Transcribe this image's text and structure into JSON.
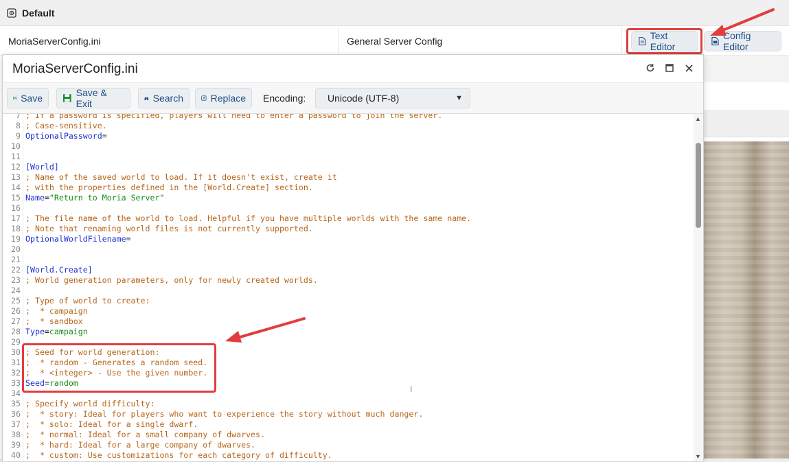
{
  "background": {
    "section_title": "Default",
    "row": {
      "filename": "MoriaServerConfig.ini",
      "description": "General Server Config",
      "text_editor_label": "Text Editor",
      "config_editor_label": "Config Editor"
    }
  },
  "modal": {
    "title": "MoriaServerConfig.ini",
    "toolbar": {
      "save_label": "Save",
      "save_exit_label": "Save & Exit",
      "search_label": "Search",
      "replace_label": "Replace",
      "encoding_label": "Encoding:",
      "encoding_value": "Unicode (UTF-8)"
    }
  },
  "editor": {
    "lines": [
      {
        "n": "7",
        "parts": [
          {
            "t": "; If a password is specified, players will need to enter a password to join the server.",
            "c": "comment"
          }
        ]
      },
      {
        "n": "8",
        "parts": [
          {
            "t": "; Case-sensitive.",
            "c": "comment"
          }
        ]
      },
      {
        "n": "9",
        "parts": [
          {
            "t": "OptionalPassword",
            "c": "key"
          },
          {
            "t": "=",
            "c": "eq"
          }
        ]
      },
      {
        "n": "10",
        "parts": []
      },
      {
        "n": "11",
        "parts": []
      },
      {
        "n": "12",
        "parts": [
          {
            "t": "[World]",
            "c": "section"
          }
        ]
      },
      {
        "n": "13",
        "parts": [
          {
            "t": "; Name of the saved world to load. If it doesn't exist, create it",
            "c": "comment"
          }
        ]
      },
      {
        "n": "14",
        "parts": [
          {
            "t": "; with the properties defined in the [World.Create] section.",
            "c": "comment"
          }
        ]
      },
      {
        "n": "15",
        "parts": [
          {
            "t": "Name",
            "c": "key"
          },
          {
            "t": "=",
            "c": "eq"
          },
          {
            "t": "\"Return to Moria Server\"",
            "c": "str"
          }
        ]
      },
      {
        "n": "16",
        "parts": []
      },
      {
        "n": "17",
        "parts": [
          {
            "t": "; The file name of the world to load. Helpful if you have multiple worlds with the same name.",
            "c": "comment"
          }
        ]
      },
      {
        "n": "18",
        "parts": [
          {
            "t": "; Note that renaming world files is not currently supported.",
            "c": "comment"
          }
        ]
      },
      {
        "n": "19",
        "parts": [
          {
            "t": "OptionalWorldFilename",
            "c": "key"
          },
          {
            "t": "=",
            "c": "eq"
          }
        ]
      },
      {
        "n": "20",
        "parts": []
      },
      {
        "n": "21",
        "parts": []
      },
      {
        "n": "22",
        "parts": [
          {
            "t": "[World.Create]",
            "c": "section"
          }
        ]
      },
      {
        "n": "23",
        "parts": [
          {
            "t": "; World generation parameters, only for newly created worlds.",
            "c": "comment"
          }
        ]
      },
      {
        "n": "24",
        "parts": []
      },
      {
        "n": "25",
        "parts": [
          {
            "t": "; Type of world to create:",
            "c": "comment"
          }
        ]
      },
      {
        "n": "26",
        "parts": [
          {
            "t": ";  * campaign",
            "c": "comment"
          }
        ]
      },
      {
        "n": "27",
        "parts": [
          {
            "t": ";  * sandbox",
            "c": "comment"
          }
        ]
      },
      {
        "n": "28",
        "parts": [
          {
            "t": "Type",
            "c": "key"
          },
          {
            "t": "=",
            "c": "eq"
          },
          {
            "t": "campaign",
            "c": "val"
          }
        ]
      },
      {
        "n": "29",
        "parts": []
      },
      {
        "n": "30",
        "parts": [
          {
            "t": "; Seed for world generation:",
            "c": "comment"
          }
        ]
      },
      {
        "n": "31",
        "parts": [
          {
            "t": ";  * random - Generates a random seed.",
            "c": "comment"
          }
        ]
      },
      {
        "n": "32",
        "parts": [
          {
            "t": ";  * <integer> - Use the given number.",
            "c": "comment"
          }
        ]
      },
      {
        "n": "33",
        "parts": [
          {
            "t": "Seed",
            "c": "key"
          },
          {
            "t": "=",
            "c": "eq"
          },
          {
            "t": "random",
            "c": "val"
          }
        ]
      },
      {
        "n": "34",
        "parts": []
      },
      {
        "n": "35",
        "parts": [
          {
            "t": "; Specify world difficulty:",
            "c": "comment"
          }
        ]
      },
      {
        "n": "36",
        "parts": [
          {
            "t": ";  * story: Ideal for players who want to experience the story without much danger.",
            "c": "comment"
          }
        ]
      },
      {
        "n": "37",
        "parts": [
          {
            "t": ";  * solo: Ideal for a single dwarf.",
            "c": "comment"
          }
        ]
      },
      {
        "n": "38",
        "parts": [
          {
            "t": ";  * normal: Ideal for a small company of dwarves.",
            "c": "comment"
          }
        ]
      },
      {
        "n": "39",
        "parts": [
          {
            "t": ";  * hard: Ideal for a large company of dwarves.",
            "c": "comment"
          }
        ]
      },
      {
        "n": "40",
        "parts": [
          {
            "t": ";  * custom: Use customizations for each category of difficulty.",
            "c": "comment"
          }
        ]
      }
    ]
  },
  "colors": {
    "accent": "#1f4f86",
    "highlight": "#e03e3e",
    "comment": "#b8661a",
    "key": "#1f2fcf",
    "value": "#128a12"
  }
}
